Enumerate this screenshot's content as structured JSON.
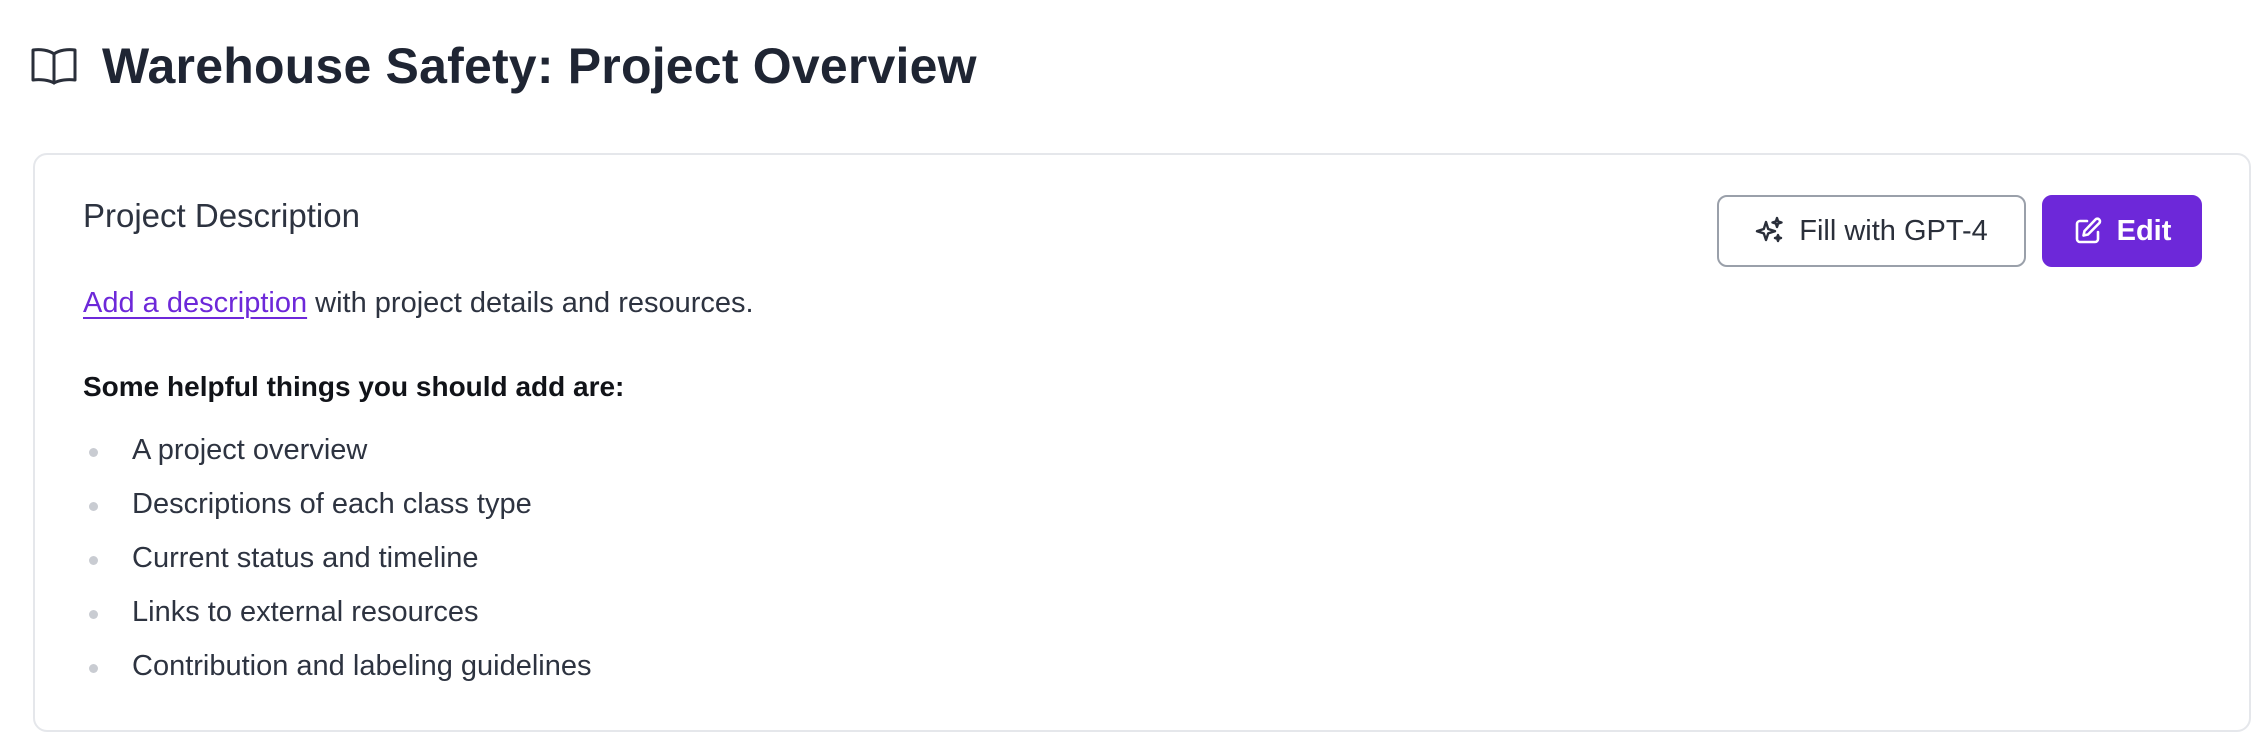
{
  "page": {
    "title": "Warehouse Safety: Project Overview",
    "title_icon": "book-open-icon"
  },
  "card": {
    "title": "Project Description",
    "actions": {
      "fill_gpt_label": "Fill with GPT-4",
      "fill_gpt_icon": "sparkles-icon",
      "edit_label": "Edit",
      "edit_icon": "edit-pencil-icon"
    },
    "intro": {
      "link_text": "Add a description",
      "rest_text": " with project details and resources."
    },
    "helpful_heading": "Some helpful things you should add are:",
    "items": [
      "A project overview",
      "Descriptions of each class type",
      "Current status and timeline",
      "Links to external resources",
      "Contribution and labeling guidelines"
    ]
  },
  "colors": {
    "accent": "#6d28d9",
    "text": "#1f2533",
    "border": "#e5e7eb",
    "bullet": "#c9ccd2"
  }
}
